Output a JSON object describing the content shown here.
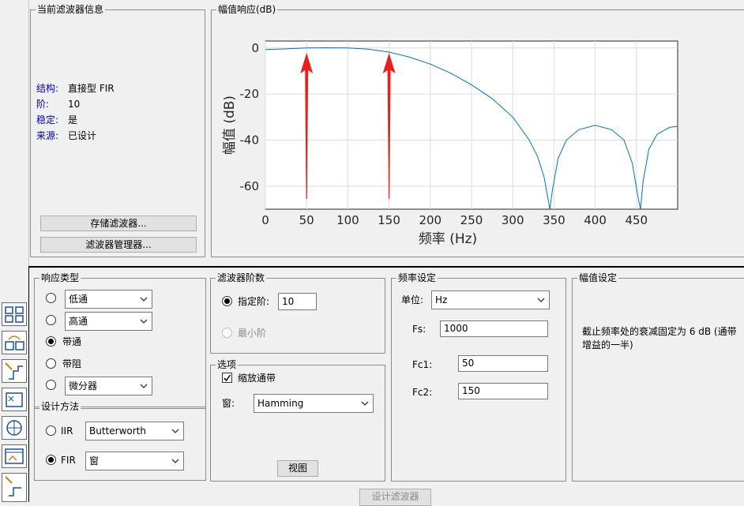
{
  "info_panel": {
    "title": "当前滤波器信息",
    "structure_key": "结构:",
    "structure_val": "直接型 FIR",
    "order_key": "阶:",
    "order_val": "10",
    "stable_key": "稳定:",
    "stable_val": "是",
    "source_key": "来源:",
    "source_val": "已设计",
    "store_button": "存储滤波器...",
    "manager_button": "滤波器管理器..."
  },
  "plot_panel": {
    "title": "幅值响应(dB)"
  },
  "chart_data": {
    "type": "line",
    "xlabel": "频率 (Hz)",
    "ylabel": "幅值 (dB)",
    "xlim": [
      0,
      500
    ],
    "ylim": [
      -70,
      3
    ],
    "xticks": [
      "0",
      "50",
      "100",
      "150",
      "200",
      "250",
      "300",
      "350",
      "400",
      "450"
    ],
    "yticks": [
      "0",
      "-20",
      "-40",
      "-60"
    ],
    "grid": true,
    "series": [
      {
        "color": "#0072bd",
        "x": [
          0,
          25,
          50,
          75,
          100,
          125,
          150,
          175,
          200,
          225,
          250,
          275,
          300,
          320,
          330,
          338,
          343,
          345,
          348,
          355,
          365,
          380,
          400,
          420,
          435,
          445,
          452,
          455,
          458,
          465,
          475,
          490,
          500
        ],
        "y": [
          -0.7,
          -0.4,
          0.0,
          0.1,
          0.0,
          -0.5,
          -1.8,
          -4.0,
          -7.0,
          -11.0,
          -16.0,
          -22.0,
          -30.0,
          -40.0,
          -47.0,
          -56.0,
          -66.0,
          -70.0,
          -62.0,
          -48.0,
          -40.0,
          -35.5,
          -33.6,
          -35.5,
          -40.0,
          -50.0,
          -65.0,
          -70.0,
          -58.0,
          -44.0,
          -37.5,
          -34.5,
          -34.0
        ]
      }
    ],
    "annotations": [
      {
        "type": "arrow",
        "color": "#e8201b",
        "x": 50
      },
      {
        "type": "arrow",
        "color": "#e8201b",
        "x": 150
      }
    ]
  },
  "response_type": {
    "title": "响应类型",
    "options": [
      {
        "label": "低通",
        "selected": false
      },
      {
        "label": "高通",
        "selected": false
      },
      {
        "label": "带通",
        "selected": true
      },
      {
        "label": "带阻",
        "selected": false
      },
      {
        "label": "微分器",
        "selected": false
      }
    ]
  },
  "design_method": {
    "title": "设计方法",
    "iir_label": "IIR",
    "iir_value": "Butterworth",
    "fir_label": "FIR",
    "fir_value": "窗"
  },
  "filter_order": {
    "title": "滤波器阶数",
    "specify_label": "指定阶:",
    "specify_value": "10",
    "minimum_label": "最小阶"
  },
  "options_panel": {
    "title": "选项",
    "scale_label": "缩放通带",
    "window_label": "窗:",
    "window_value": "Hamming",
    "view_button": "视图"
  },
  "freq_spec": {
    "title": "频率设定",
    "unit_label": "单位:",
    "unit_value": "Hz",
    "fs_label": "Fs:",
    "fs_value": "1000",
    "fc1_label": "Fc1:",
    "fc1_value": "50",
    "fc2_label": "Fc2:",
    "fc2_value": "150"
  },
  "mag_spec": {
    "title": "幅值设定",
    "note": "截止频率处的衰减固定为 6 dB (通带增益的一半)"
  },
  "design_button": "设计滤波器",
  "toolbar": [
    "cascade-icon",
    "transform-icon",
    "design-filter-icon",
    "pole-zero-icon",
    "multirate-icon",
    "import-icon",
    "realize-model-icon"
  ]
}
